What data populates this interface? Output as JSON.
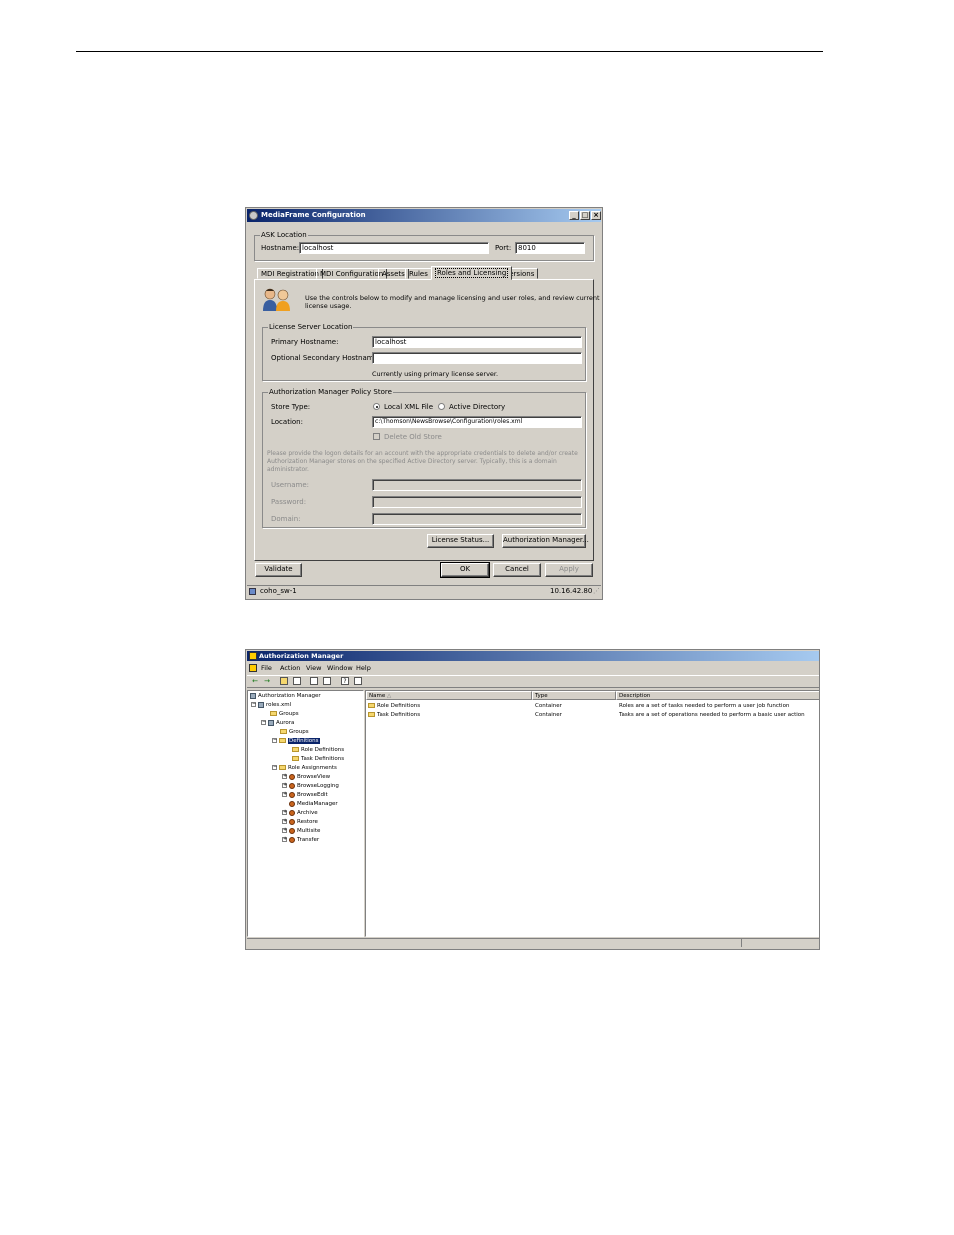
{
  "config_window": {
    "title": "MediaFrame Configuration",
    "ask_location": {
      "legend": "ASK Location",
      "hostname_label": "Hostname:",
      "hostname_value": "localhost",
      "port_label": "Port:",
      "port_value": "8010"
    },
    "tabs": [
      "MDI Registration",
      "MDI Configuration",
      "Assets",
      "Rules",
      "Roles and Licensing",
      "Versions"
    ],
    "active_tab": "Roles and Licensing",
    "intro_text": "Use the controls below to modify and manage licensing and user roles, and review current",
    "intro_text2": "license usage.",
    "license_server": {
      "legend": "License Server Location",
      "primary_label": "Primary Hostname:",
      "primary_value": "localhost",
      "secondary_label": "Optional Secondary Hostname:",
      "secondary_value": "",
      "status_text": "Currently using primary license server."
    },
    "policy_store": {
      "legend": "Authorization Manager Policy Store",
      "store_type_label": "Store Type:",
      "option_local": "Local XML File",
      "option_ad": "Active Directory",
      "location_label": "Location:",
      "location_value": "c:\\Thomson\\NewsBrowse\\Configuration\\roles.xml",
      "delete_label": "Delete Old Store",
      "credentials_note1": "Please provide the logon details for an account with the appropriate credentials to delete and/or create",
      "credentials_note2": "Authorization Manager stores on the specified Active Directory server. Typically, this is a domain",
      "credentials_note3": "administrator.",
      "username_label": "Username:",
      "password_label": "Password:",
      "domain_label": "Domain:"
    },
    "buttons": {
      "license_status": "License Status...",
      "authorization_manager": "Authorization Manager...",
      "validate": "Validate",
      "ok": "OK",
      "cancel": "Cancel",
      "apply": "Apply"
    },
    "status_bar": {
      "left": "coho_sw-1",
      "right": "10.16.42.80"
    }
  },
  "authman_window": {
    "title": "Authorization Manager",
    "menu": [
      "File",
      "Action",
      "View",
      "Window",
      "Help"
    ],
    "tree": {
      "root": "Authorization Manager",
      "store": "roles.xml",
      "groups": "Groups",
      "app": "Aurora",
      "app_groups": "Groups",
      "definitions": "Definitions",
      "role_definitions": "Role Definitions",
      "task_definitions": "Task Definitions",
      "role_assignments": "Role Assignments",
      "roles": [
        "BrowseView",
        "BrowseLogging",
        "BrowseEdit",
        "MediaManager",
        "Archive",
        "Restore",
        "Multisite",
        "Transfer"
      ]
    },
    "columns": [
      "Name",
      "Type",
      "Description"
    ],
    "rows": [
      {
        "name": "Role Definitions",
        "type": "Container",
        "description": "Roles are a set of tasks needed to perform a user job function"
      },
      {
        "name": "Task Definitions",
        "type": "Container",
        "description": "Tasks are a set of operations needed to perform a basic user action"
      }
    ]
  },
  "colors": {
    "title_gradient_start": "#0a246a",
    "title_gradient_end": "#a6caf0",
    "window_face": "#d4d0c8"
  }
}
